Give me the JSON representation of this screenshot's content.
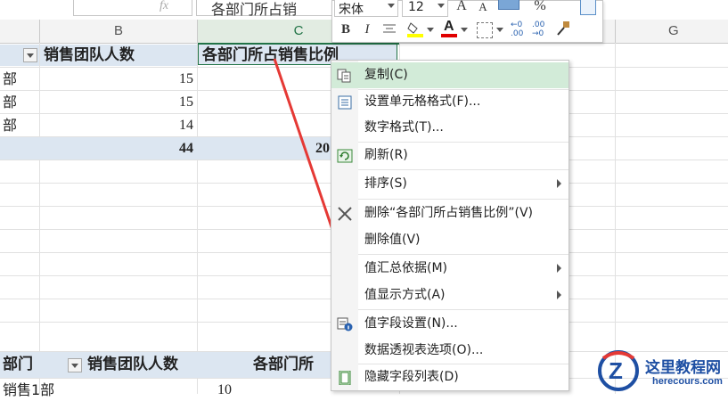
{
  "formula_bar": {
    "name_box_fragment": "fx",
    "content_fragment": "各部门所占销"
  },
  "columns": [
    {
      "letter": "B"
    },
    {
      "letter": "C"
    },
    {
      "letter": "G"
    }
  ],
  "pivot_top": {
    "header_b": "销售团队人数",
    "header_c": "各部门所占销售比例",
    "rows": [
      {
        "label": "部",
        "value": "15"
      },
      {
        "label": "部",
        "value": "15"
      },
      {
        "label": "部",
        "value": "14"
      }
    ],
    "total_value": "44",
    "total_c_fragment": "20"
  },
  "pivot_bottom": {
    "header_a": "部门",
    "header_b": "销售团队人数",
    "header_c": "各部门所",
    "row1_label": "销售1部",
    "row1_value": "10"
  },
  "mini_toolbar": {
    "font_name": "宋体",
    "font_size": "12",
    "grow_font": "A",
    "shrink_font": "A",
    "percent": "%",
    "bold": "B",
    "italic": "I",
    "font_color_letter": "A",
    "fill_color": "#ffff00",
    "font_color": "#e00000"
  },
  "context_menu": {
    "items": [
      {
        "label": "复制(C)",
        "icon": "copy-icon"
      },
      {
        "label": "设置单元格格式(F)...",
        "icon": "format-cells-icon"
      },
      {
        "label": "数字格式(T)...",
        "icon": ""
      },
      {
        "label": "刷新(R)",
        "icon": "refresh-icon"
      },
      {
        "label": "排序(S)",
        "icon": ""
      },
      {
        "label": "删除“各部门所占销售比例”(V)",
        "icon": "delete-x-icon"
      },
      {
        "label": "删除值(V)",
        "icon": ""
      },
      {
        "label": "值汇总依据(M)",
        "icon": ""
      },
      {
        "label": "值显示方式(A)",
        "icon": ""
      },
      {
        "label": "值字段设置(N)...",
        "icon": "field-settings-icon"
      },
      {
        "label": "数据透视表选项(O)...",
        "icon": ""
      },
      {
        "label": "隐藏字段列表(D)",
        "icon": "field-list-icon"
      }
    ]
  },
  "annotation": {
    "arrow_color": "#e53935"
  },
  "watermark": {
    "title": "这里教程网",
    "url": "herecours.com"
  }
}
